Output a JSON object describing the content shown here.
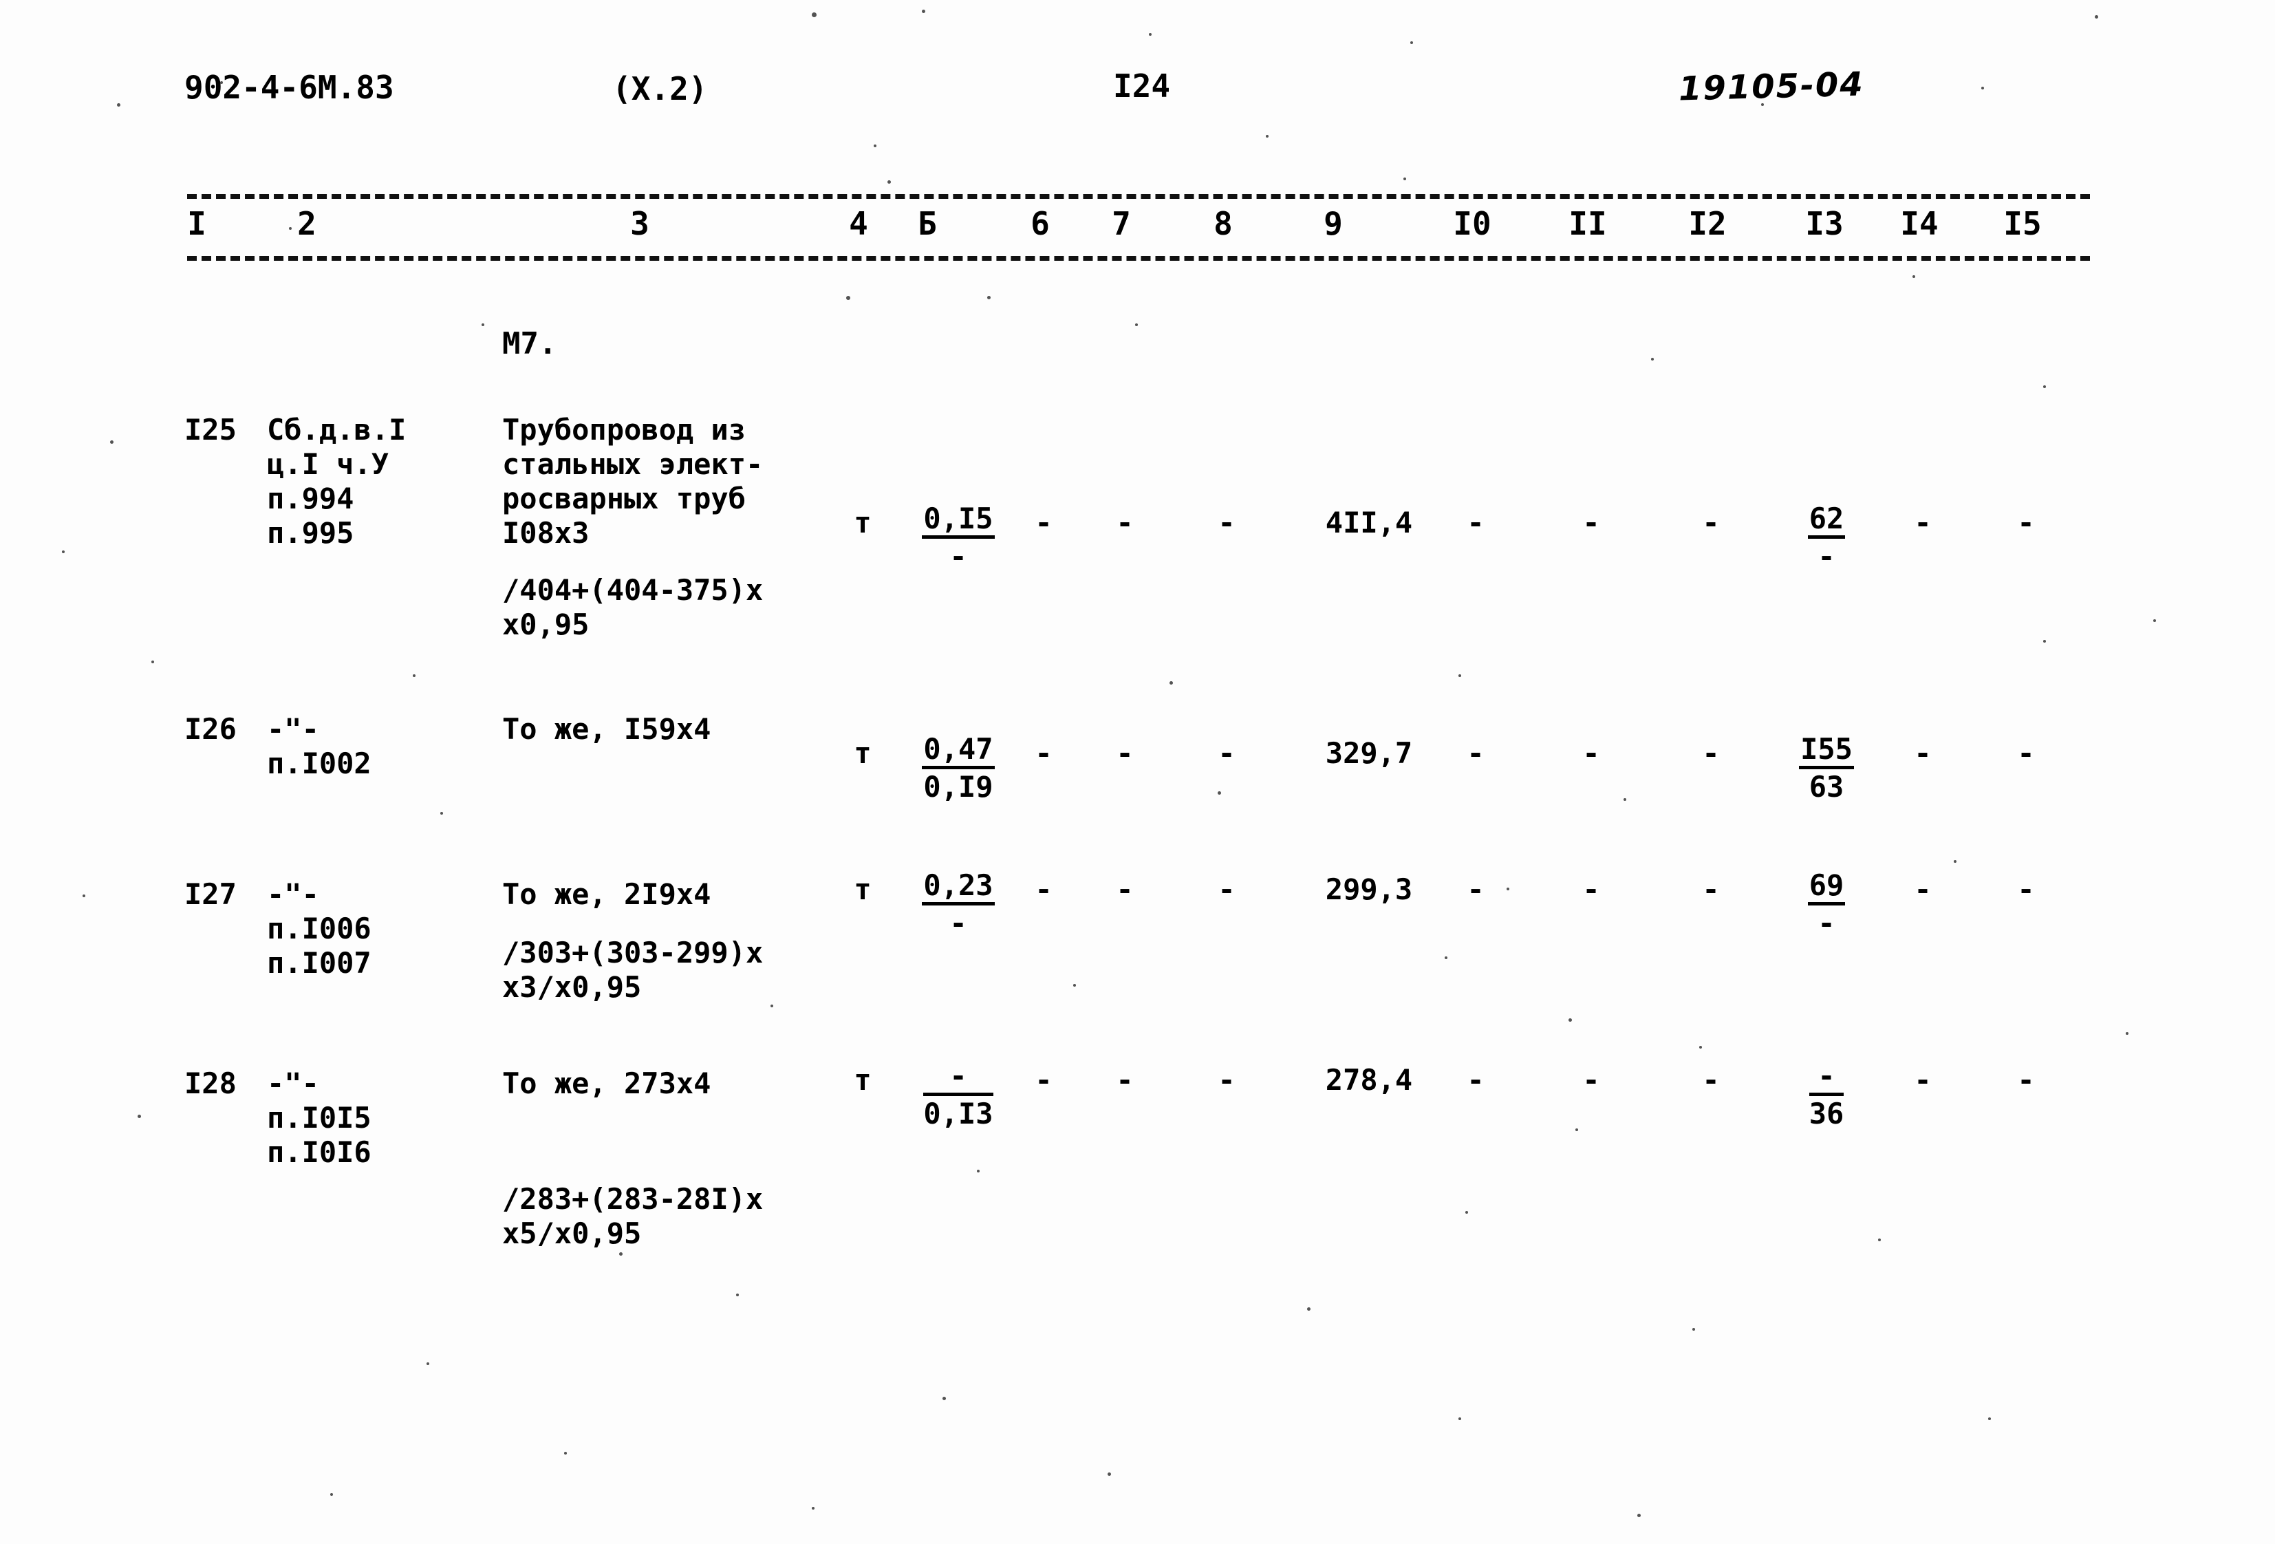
{
  "header": {
    "doc_number": "902-4-6М.83",
    "section": "(Х.2)",
    "page_number": "I24",
    "handwritten_note": "19105-04"
  },
  "table": {
    "column_numbers": [
      "I",
      "2",
      "3",
      "4",
      "Б",
      "6",
      "7",
      "8",
      "9",
      "I0",
      "II",
      "I2",
      "I3",
      "I4",
      "I5"
    ],
    "group_label": "М7.",
    "rows": [
      {
        "num": "I25",
        "ref_lines": [
          "Сб.д.в.I",
          "ц.I ч.У",
          "п.994",
          "п.995"
        ],
        "desc_lines": [
          "Трубопровод из",
          "стальных элект-",
          "росварных труб",
          "I08х3"
        ],
        "formula_lines": [
          "/404+(404-375)х",
          "х0,95"
        ],
        "unit": "т",
        "c5_num": "0,I5",
        "c5_den": "-",
        "c6": "-",
        "c7": "-",
        "c8": "-",
        "c9": "4II,4",
        "c10": "-",
        "c11": "-",
        "c12": "-",
        "c13_num": "62",
        "c13_den": "-",
        "c14": "-",
        "c15": "-"
      },
      {
        "num": "I26",
        "ref_lines": [
          "-\"-",
          "п.I002"
        ],
        "desc_lines": [
          "То же, I59х4"
        ],
        "formula_lines": [],
        "unit": "т",
        "c5_num": "0,47",
        "c5_den": "0,I9",
        "c6": "-",
        "c7": "-",
        "c8": "-",
        "c9": "329,7",
        "c10": "-",
        "c11": "-",
        "c12": "-",
        "c13_num": "I55",
        "c13_den": "63",
        "c14": "-",
        "c15": "-"
      },
      {
        "num": "I27",
        "ref_lines": [
          "-\"-",
          "п.I006",
          "п.I007"
        ],
        "desc_lines": [
          "То же, 2I9х4"
        ],
        "formula_lines": [
          "/303+(303-299)х",
          "х3/х0,95"
        ],
        "unit": "т",
        "c5_num": "0,23",
        "c5_den": "-",
        "c6": "-",
        "c7": "-",
        "c8": "-",
        "c9": "299,3",
        "c10": "-",
        "c11": "-",
        "c12": "-",
        "c13_num": "69",
        "c13_den": "-",
        "c14": "-",
        "c15": "-"
      },
      {
        "num": "I28",
        "ref_lines": [
          "-\"-",
          "п.I0I5",
          "п.I0I6"
        ],
        "desc_lines": [
          "То же, 273х4"
        ],
        "formula_lines": [
          "/283+(283-28I)х",
          "х5/х0,95"
        ],
        "unit": "т",
        "c5_num": "-",
        "c5_den": "0,I3",
        "c6": "-",
        "c7": "-",
        "c8": "-",
        "c9": "278,4",
        "c10": "-",
        "c11": "-",
        "c12": "-",
        "c13_num": "-",
        "c13_den": "36",
        "c14": "-",
        "c15": "-"
      }
    ]
  }
}
